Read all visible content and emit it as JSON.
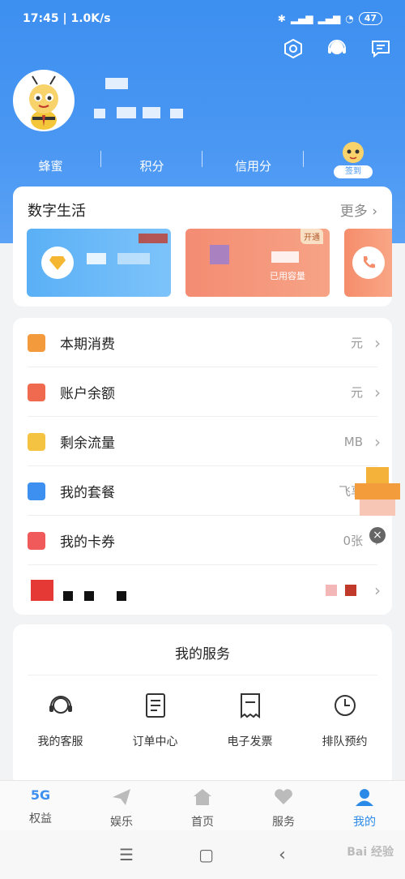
{
  "status_bar": {
    "time": "17:45",
    "speed": "1.0K/s",
    "battery": "47"
  },
  "profile": {
    "stats": [
      "蜂蜜",
      "积分",
      "信用分"
    ],
    "sign_label": "签到"
  },
  "digital_life": {
    "title": "数字生活",
    "more": "更多",
    "tile2_label": "已用容量",
    "tile2_tag": "开通"
  },
  "menu": {
    "items": [
      {
        "label": "本期消费",
        "value": "元"
      },
      {
        "label": "账户余额",
        "value": "元"
      },
      {
        "label": "剩余流量",
        "value": "MB"
      },
      {
        "label": "我的套餐",
        "value": "飞享"
      },
      {
        "label": "我的卡券",
        "value": "0张"
      },
      {
        "label": "",
        "value": ""
      }
    ]
  },
  "services": {
    "title": "我的服务",
    "items": [
      "我的客服",
      "订单中心",
      "电子发票",
      "排队预约"
    ]
  },
  "tabbar": {
    "tabs": [
      "权益",
      "娱乐",
      "首页",
      "服务",
      "我的"
    ],
    "badge_5g": "5G"
  },
  "watermark": "Bai 经验",
  "colors": {
    "primary": "#3d8ff0",
    "active_tab": "#2b8ae8"
  }
}
